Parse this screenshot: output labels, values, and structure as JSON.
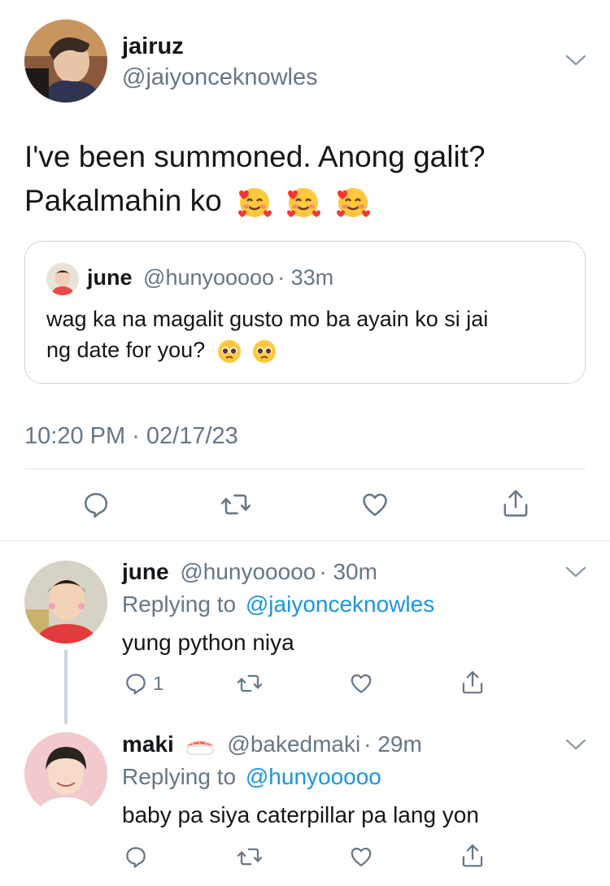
{
  "main_tweet": {
    "author_name": "jairuz",
    "author_handle": "@jaiyonceknowles",
    "text_line1": "I've been summoned. Anong galit?",
    "text_line2": "Pakalmahin ko",
    "timestamp": "10:20 PM · 02/17/23",
    "quote": {
      "author_name": "june",
      "author_handle": "@hunyooooo",
      "time": "· 33m",
      "text_line1": "wag ka na magalit gusto mo ba ayain ko si jai",
      "text_line2": "ng date for you?"
    },
    "actions": [
      "reply-icon",
      "retweet-icon",
      "like-icon",
      "share-icon"
    ]
  },
  "replies": [
    {
      "author_name": "june",
      "author_handle": "@hunyooooo",
      "time": "· 30m",
      "replying_prefix": "Replying to",
      "replying_to": "@jaiyonceknowles",
      "text": "yung python niya",
      "reply_count": "1"
    },
    {
      "author_name": "maki",
      "author_handle": "@bakedmaki",
      "time": "· 29m",
      "replying_prefix": "Replying to",
      "replying_to": "@hunyooooo",
      "text": "baby pa siya caterpillar pa lang yon",
      "reply_count": ""
    }
  ],
  "colors": {
    "text": "#14171a",
    "secondary": "#657786",
    "link": "#1b95e0",
    "divider": "#e1e8ed"
  }
}
